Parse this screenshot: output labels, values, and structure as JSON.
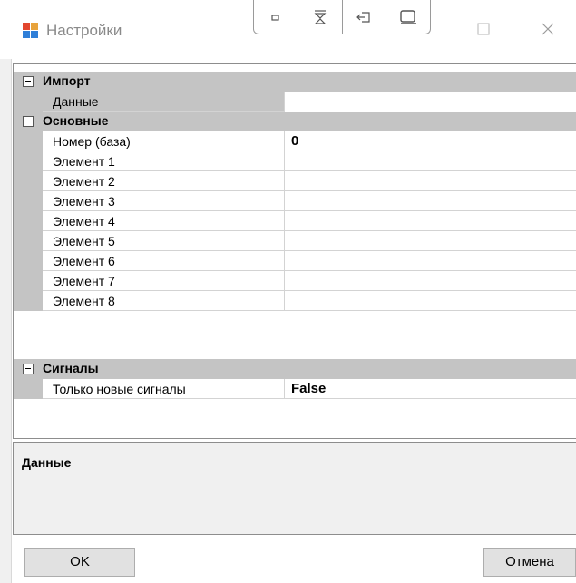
{
  "window": {
    "title": "Настройки"
  },
  "grid": {
    "categories": [
      {
        "label": "Импорт",
        "properties": [
          {
            "name": "Данные",
            "value": ""
          }
        ]
      },
      {
        "label": "Основные",
        "properties": [
          {
            "name": "Номер (база)",
            "value": "0"
          },
          {
            "name": "Элемент 1",
            "value": ""
          },
          {
            "name": "Элемент 2",
            "value": ""
          },
          {
            "name": "Элемент 3",
            "value": ""
          },
          {
            "name": "Элемент 4",
            "value": ""
          },
          {
            "name": "Элемент 5",
            "value": ""
          },
          {
            "name": "Элемент 6",
            "value": ""
          },
          {
            "name": "Элемент 7",
            "value": ""
          },
          {
            "name": "Элемент 8",
            "value": ""
          }
        ]
      },
      {
        "label": "Сигналы",
        "properties": [
          {
            "name": "Только новые сигналы",
            "value": "False"
          }
        ]
      }
    ],
    "selected_property": "Данные"
  },
  "description": {
    "title": "Данные"
  },
  "buttons": {
    "ok_label": "OK",
    "cancel_label": "Отмена"
  },
  "icons": {
    "app": "app-icon",
    "snap_layouts": [
      "snap-small-icon",
      "snap-top-icon",
      "snap-side-icon",
      "snap-full-icon"
    ],
    "maximize": "maximize-icon",
    "close": "close-icon",
    "collapse": "collapse-icon"
  }
}
